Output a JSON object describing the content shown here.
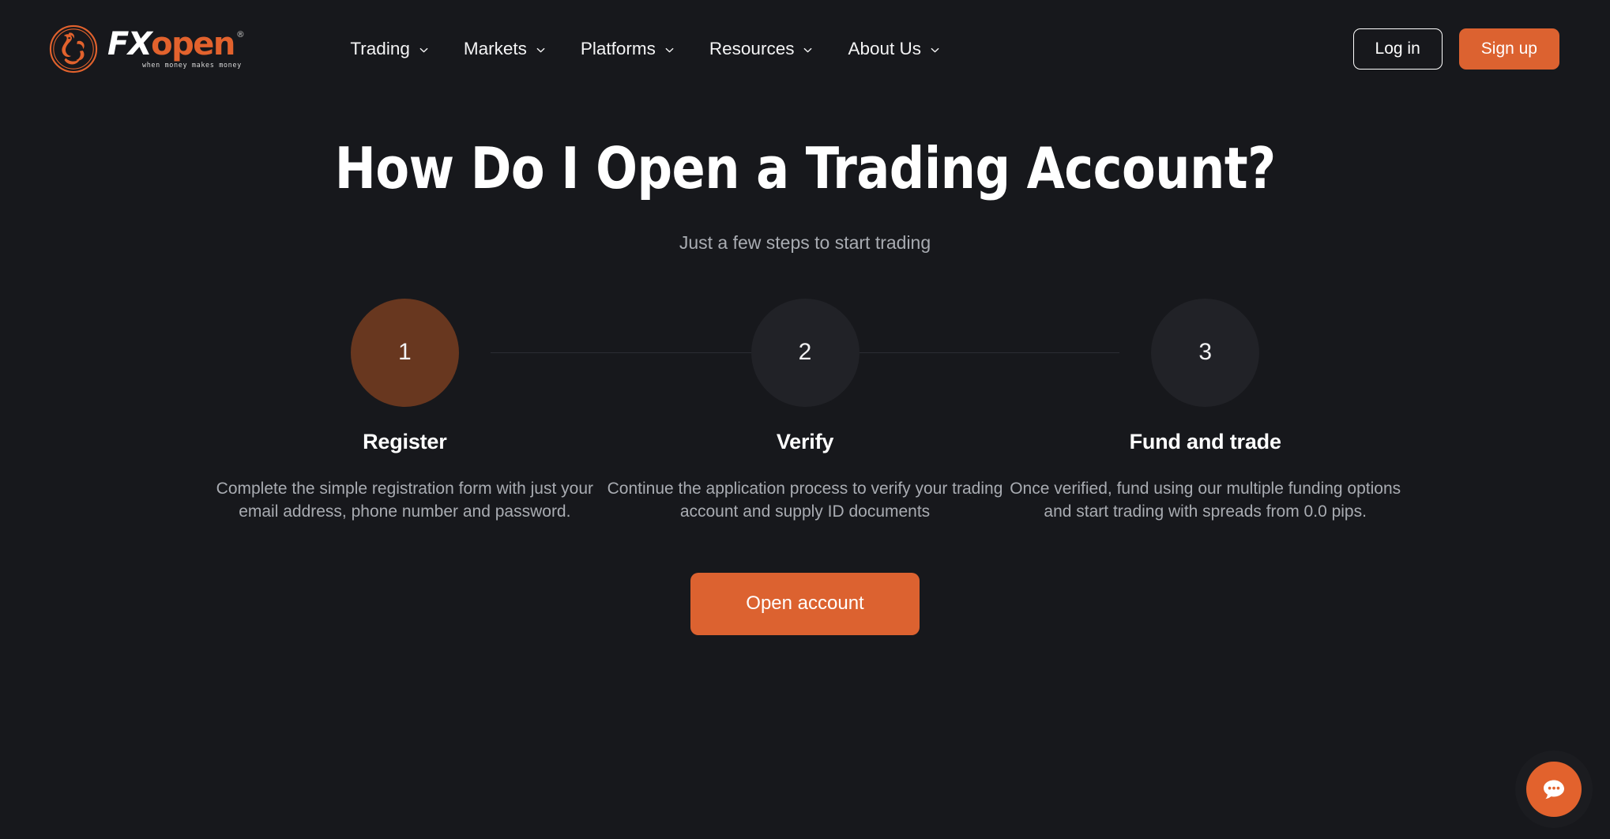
{
  "theme": {
    "background": "#17181c",
    "accent": "#dc6230",
    "accent_muted": "#68371f",
    "text_primary": "#ffffff",
    "text_muted": "#a9acb2",
    "circle_idle": "#212227",
    "line": "#2b2d33"
  },
  "header": {
    "logo": {
      "icon": "fxopen-bull-emblem-icon",
      "text_primary": "FX",
      "text_accent": "open",
      "registered_mark": "®",
      "tagline": "when money makes money"
    },
    "nav": [
      {
        "label": "Trading",
        "icon": "chevron-down-icon"
      },
      {
        "label": "Markets",
        "icon": "chevron-down-icon"
      },
      {
        "label": "Platforms",
        "icon": "chevron-down-icon"
      },
      {
        "label": "Resources",
        "icon": "chevron-down-icon"
      },
      {
        "label": "About Us",
        "icon": "chevron-down-icon"
      }
    ],
    "login_label": "Log in",
    "signup_label": "Sign up"
  },
  "main": {
    "title": "How Do I Open a Trading Account?",
    "subtitle": "Just a few steps to start trading",
    "steps": [
      {
        "number": "1",
        "title": "Register",
        "description": "Complete the simple registration form with just your email address, phone number and password.",
        "state": "active"
      },
      {
        "number": "2",
        "title": "Verify",
        "description": "Continue the application process to verify your trading account and supply ID documents",
        "state": "idle"
      },
      {
        "number": "3",
        "title": "Fund and trade",
        "description": "Once verified, fund using our multiple funding options and start trading with spreads from 0.0 pips.",
        "state": "idle"
      }
    ],
    "cta_label": "Open account"
  },
  "chat": {
    "icon": "chat-bubble-icon",
    "dots": 3
  }
}
